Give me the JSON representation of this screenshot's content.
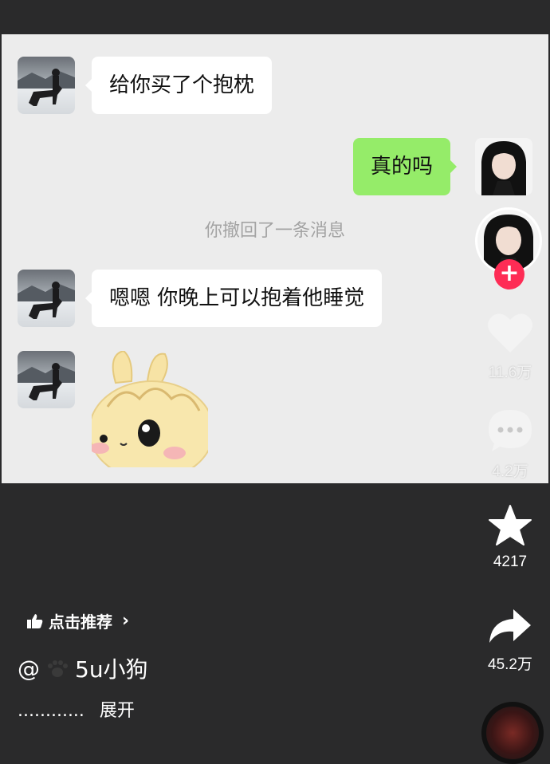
{
  "chat": {
    "msg1": "给你买了个抱枕",
    "msg2": "真的吗",
    "recall_notice": "你撤回了一条消息",
    "msg3": "嗯嗯 你晚上可以抱着他睡觉",
    "sticker": "bunny-sticker"
  },
  "actions": {
    "likes": "11.6万",
    "comments": "4.2万",
    "favorites": "4217",
    "shares": "45.2万",
    "follow_symbol": "+"
  },
  "info": {
    "recommend_label": "点击推荐",
    "author_prefix": "@",
    "author_name": "5u小狗",
    "description": "............",
    "expand_label": "展开"
  },
  "colors": {
    "accent": "#fe2c55",
    "sent_bubble": "#95ec69",
    "background": "#2a2a2b"
  }
}
